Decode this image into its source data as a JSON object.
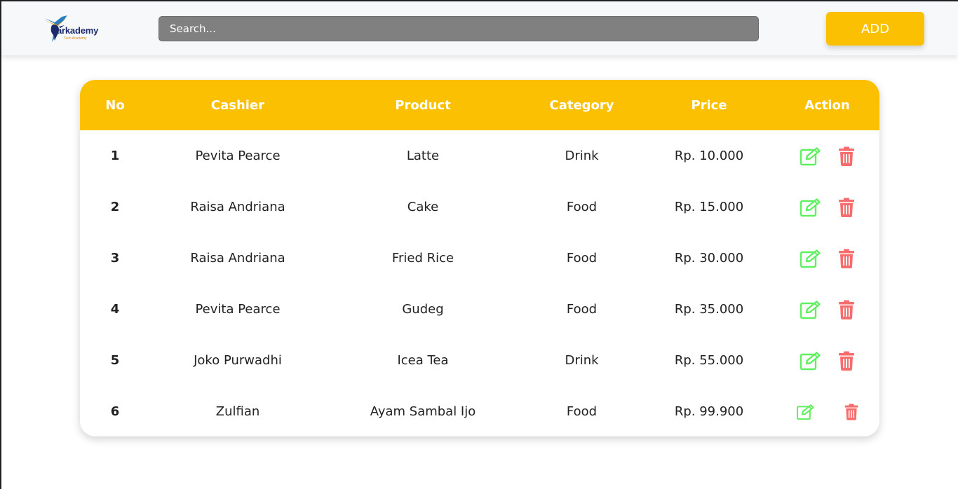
{
  "header": {
    "logo_text": "arkademy",
    "logo_subtext": "Tech Academy",
    "search_placeholder": "Search...",
    "add_label": "ADD"
  },
  "table": {
    "columns": [
      "No",
      "Cashier",
      "Product",
      "Category",
      "Price",
      "Action"
    ],
    "rows": [
      {
        "no": "1",
        "cashier": "Pevita Pearce",
        "product": "Latte",
        "category": "Drink",
        "price": "Rp. 10.000"
      },
      {
        "no": "2",
        "cashier": "Raisa Andriana",
        "product": "Cake",
        "category": "Food",
        "price": "Rp. 15.000"
      },
      {
        "no": "3",
        "cashier": "Raisa Andriana",
        "product": "Fried Rice",
        "category": "Food",
        "price": "Rp. 30.000"
      },
      {
        "no": "4",
        "cashier": "Pevita Pearce",
        "product": "Gudeg",
        "category": "Food",
        "price": "Rp. 35.000"
      },
      {
        "no": "5",
        "cashier": "Joko Purwadhi",
        "product": "Icea Tea",
        "category": "Drink",
        "price": "Rp. 55.000"
      },
      {
        "no": "6",
        "cashier": "Zulfian",
        "product": "Ayam Sambal Ijo",
        "category": "Food",
        "price": "Rp. 99.900"
      }
    ]
  },
  "icons": {
    "edit": "edit-icon",
    "delete": "trash-icon"
  },
  "colors": {
    "accent": "#fcc002",
    "search_bg": "#808080",
    "edit_icon": "#5ff05f",
    "delete_icon": "#f76c6c",
    "logo_text": "#1b2a6b"
  }
}
